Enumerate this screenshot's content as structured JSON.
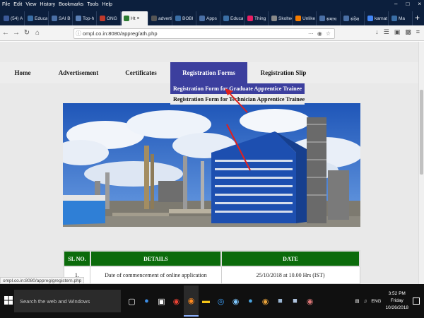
{
  "browser": {
    "menu": [
      "File",
      "Edit",
      "View",
      "History",
      "Bookmarks",
      "Tools",
      "Help"
    ],
    "window_controls": [
      "–",
      "□",
      "×"
    ],
    "tabs": [
      {
        "label": "(54) A",
        "fav": "#3b5998"
      },
      {
        "label": "Educa",
        "fav": "#3a6ea5"
      },
      {
        "label": "SAI B",
        "fav": "#4a6fa5"
      },
      {
        "label": "Top-h",
        "fav": "#5a7fb5"
      },
      {
        "label": "ONG",
        "fav": "#c0392b"
      },
      {
        "label": "Ht",
        "fav": "#2e7d32",
        "active": true
      },
      {
        "label": "advertisem",
        "fav": "#555555"
      },
      {
        "label": "BOBI",
        "fav": "#3a6ea5"
      },
      {
        "label": "Apps",
        "fav": "#4a6fa5"
      },
      {
        "label": "Educa",
        "fav": "#3a6ea5"
      },
      {
        "label": "Thing",
        "fav": "#e91e63"
      },
      {
        "label": "Skoltec",
        "fav": "#888888"
      },
      {
        "label": "Unlike",
        "fav": "#f57c00"
      },
      {
        "label": "समाच",
        "fav": "#4a6fa5"
      },
      {
        "label": "संदेश",
        "fav": "#4a6fa5"
      },
      {
        "label": "karnat",
        "fav": "#4285f4"
      },
      {
        "label": "Ma",
        "fav": "#3a6ea5"
      }
    ],
    "tab_close": "×",
    "new_tab": "+",
    "url": "ompl.co.in:8080/appreg/ath.php",
    "status_url": "ompl.co.in:8080/appreg/gregistern.php"
  },
  "site": {
    "nav": [
      {
        "label": "Home"
      },
      {
        "label": "Advertisement"
      },
      {
        "label": "Certificates"
      },
      {
        "label": "Registration Forms",
        "active": true
      },
      {
        "label": "Registration Slip"
      }
    ],
    "dropdown": [
      {
        "label": "Registration Form for Graduate Apprentice Trainee",
        "highlighted": true
      },
      {
        "label": "Registration Form for Technician Apprentice Trainee",
        "highlighted": false
      }
    ],
    "accent": "#3c3f9e",
    "table": {
      "headers": [
        "SL NO.",
        "DETAILS",
        "DATE"
      ],
      "header_color": "#0b6b0b",
      "rows": [
        [
          "1.",
          "Date of commencement of online application",
          "25/10/2018 at 10.00 Hrs (IST)"
        ]
      ]
    }
  },
  "taskbar": {
    "search_placeholder": "Search the web and Windows",
    "lang": "ENG",
    "time": "3:52 PM",
    "day": "Friday",
    "date": "10/26/2018"
  }
}
